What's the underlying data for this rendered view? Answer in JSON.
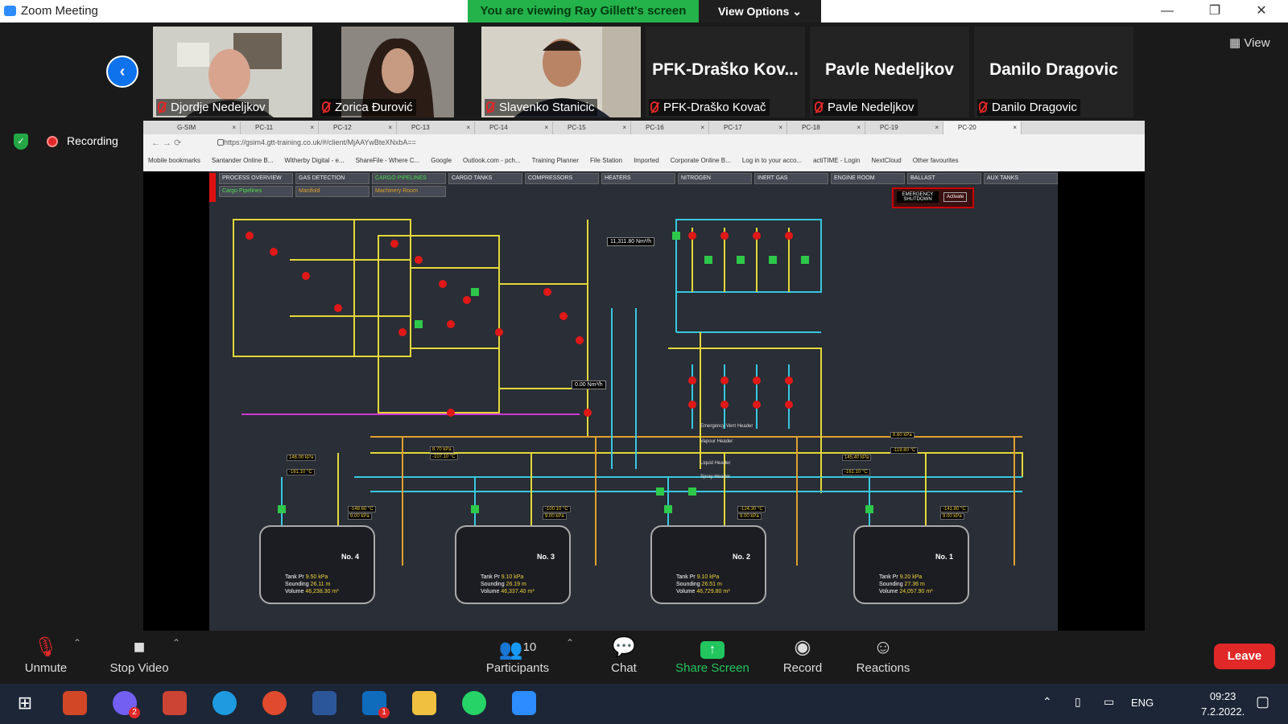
{
  "window": {
    "title": "Zoom Meeting",
    "min": "—",
    "max": "❐",
    "close": "✕"
  },
  "banner": {
    "viewing": "You are viewing Ray Gillett's screen",
    "view_options": "View Options ⌄"
  },
  "participants": [
    {
      "name": "Djordje Nedeljkov",
      "video": true
    },
    {
      "name": "Zorica Đurović",
      "video": true
    },
    {
      "name": "Slavenko Stanicic",
      "video": true
    },
    {
      "name": "PFK-Draško Kovač",
      "display": "PFK-Draško  Kov...",
      "video": false
    },
    {
      "name": "Pavle Nedeljkov",
      "display": "Pavle Nedeljkov",
      "video": false
    },
    {
      "name": "Danilo Dragovic",
      "display": "Danilo Dragovic",
      "video": false
    }
  ],
  "view_button": "View",
  "recording": "Recording",
  "browser": {
    "tabs": [
      "G-SIM",
      "PC-11",
      "PC-12",
      "PC-13",
      "PC-14",
      "PC-15",
      "PC-16",
      "PC-17",
      "PC-18",
      "PC-19",
      "PC-20"
    ],
    "url": "https://gsim4.gtt-training.co.uk/#/client/MjAAYwBteXNxbA==",
    "bookmarks": [
      "Mobile bookmarks",
      "Santander Online B...",
      "Witherby Digital - e...",
      "ShareFile - Where C...",
      "Google",
      "Outlook.com - pch...",
      "Training Planner",
      "File Station",
      "Imported",
      "Corporate Online B...",
      "Log in to your acco...",
      "actiTIME - Login",
      "NextCloud",
      "Other favourites"
    ]
  },
  "scada": {
    "menu_row1": [
      "PROCESS OVERVIEW",
      "GAS DETECTION",
      "CARGO PIPELINES",
      "CARGO TANKS",
      "COMPRESSORS",
      "HEATERS",
      "NITROGEN",
      "INERT GAS",
      "ENGINE ROOM",
      "BALLAST",
      "AUX TANKS"
    ],
    "menu_row2": [
      "Cargo Pipelines",
      "Manifold",
      "Machinery Room"
    ],
    "emergency": "EMERGENCY SHUTDOWN",
    "activate": "Activate",
    "flow1": "11,311.80 Nm³/h",
    "flow2": "0.00 Nm³/h",
    "headers": [
      "Emergency Vent Header",
      "Vapour Header",
      "Liquid Header",
      "Spray Header"
    ],
    "readings": [
      "146.00 kPa",
      "-161.10 °C",
      "8.70 kPa",
      "-107.10 °C",
      "8.60 kPa",
      "-119.80 °C",
      "145.40 kPa",
      "-161.10 °C",
      "-148.60 °C",
      "9.00 kPa",
      "-100.10 °C",
      "9.00 kPa",
      "-124.30 °C",
      "9.00 kPa",
      "-141.80 °C",
      "9.00 kPa"
    ],
    "tanks": [
      {
        "no": "No. 4",
        "pr": "9.50 kPa",
        "snd": "26.11 m",
        "vol": "46,238.30 m³"
      },
      {
        "no": "No. 3",
        "pr": "9.10 kPa",
        "snd": "26.19 m",
        "vol": "46,337.40 m³"
      },
      {
        "no": "No. 2",
        "pr": "9.10 kPa",
        "snd": "26.51 m",
        "vol": "46,729.80 m³"
      },
      {
        "no": "No. 1",
        "pr": "9.20 kPa",
        "snd": "27.36 m",
        "vol": "24,057.90 m³"
      }
    ],
    "tank_labels": {
      "pr": "Tank Pr",
      "snd": "Sounding",
      "vol": "Volume"
    }
  },
  "controls": {
    "unmute": "Unmute",
    "stop_video": "Stop Video",
    "participants": "Participants",
    "participant_count": "10",
    "chat": "Chat",
    "share": "Share Screen",
    "record": "Record",
    "reactions": "Reactions",
    "leave": "Leave"
  },
  "taskbar": {
    "lang": "ENG",
    "time": "09:23",
    "date": "7.2.2022.",
    "badge_viber": "2",
    "badge_outlook": "1"
  }
}
